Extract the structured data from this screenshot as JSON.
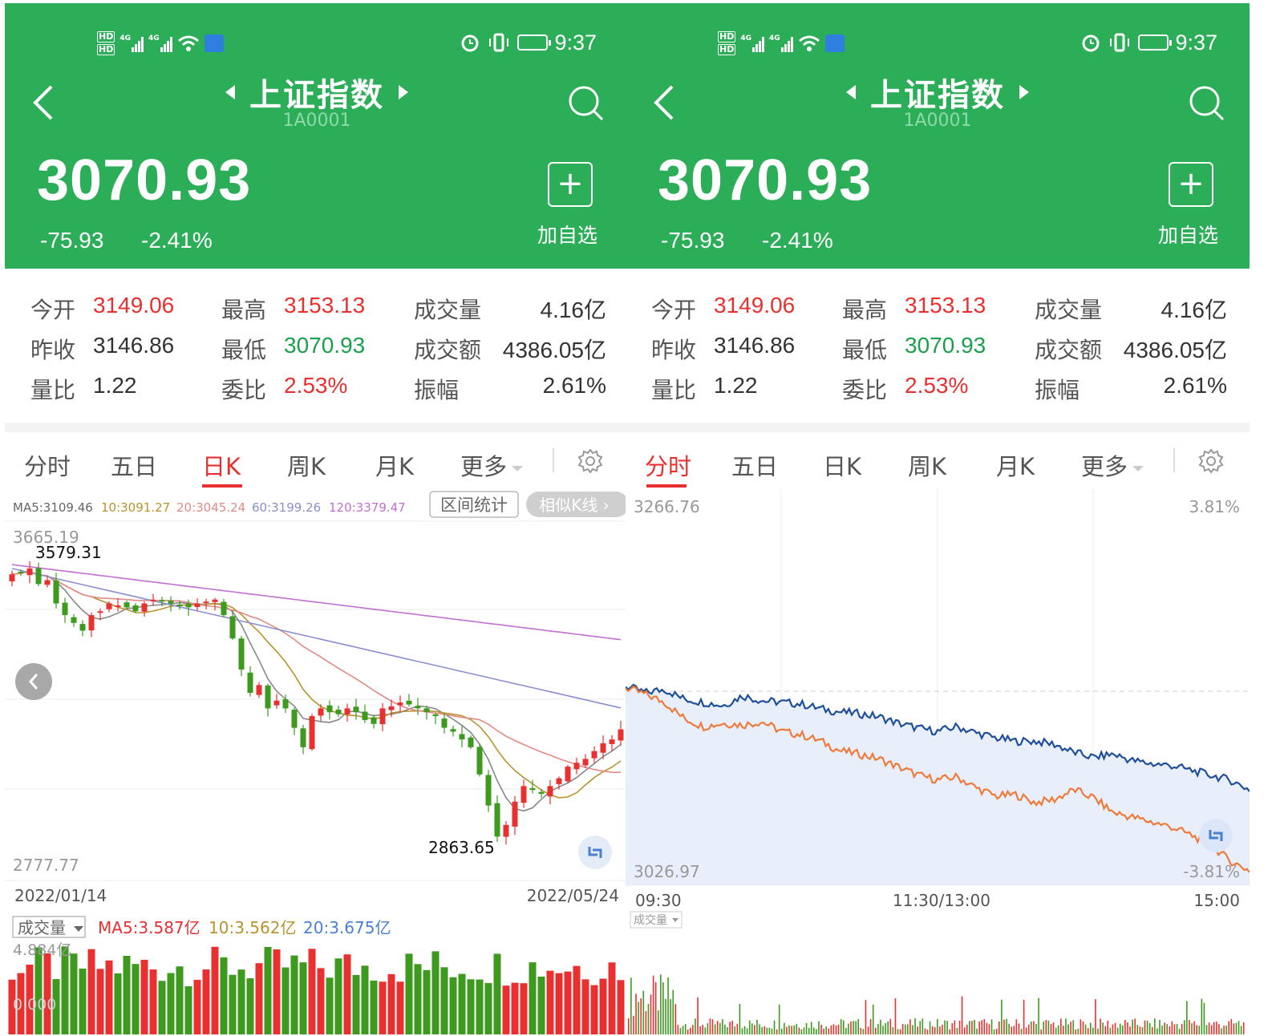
{
  "status_bar": {
    "time": "9:37",
    "hd1": "HD",
    "hd2": "HD",
    "net1": "4G",
    "net2": "4G"
  },
  "header": {
    "title": "上证指数",
    "code": "1A0001",
    "price": "3070.93",
    "change": "-75.93",
    "change_pct": "-2.41%",
    "add_icon": "+",
    "add_label": "加自选"
  },
  "stats": {
    "open_label": "今开",
    "open": "3149.06",
    "high_label": "最高",
    "high": "3153.13",
    "volume_label": "成交量",
    "volume": "4.16亿",
    "prev_close_label": "昨收",
    "prev_close": "3146.86",
    "low_label": "最低",
    "low": "3070.93",
    "amount_label": "成交额",
    "amount": "4386.05亿",
    "vol_ratio_label": "量比",
    "vol_ratio": "1.22",
    "bid_ratio_label": "委比",
    "bid_ratio": "2.53%",
    "amplitude_label": "振幅",
    "amplitude": "2.61%"
  },
  "tabs": [
    "分时",
    "五日",
    "日K",
    "周K",
    "月K",
    "更多"
  ],
  "left_panel": {
    "active_tab": 2,
    "ma_legend": [
      "MA5:3109.46",
      "10:3091.27",
      "20:3045.24",
      "60:3199.26",
      "120:3379.47"
    ],
    "range_stat_button": "区间统计",
    "similar_k_button": "相似K线 ›",
    "y_top": "3665.19",
    "y_bottom": "2777.77",
    "high_marker": "3579.31",
    "low_marker": "2863.65",
    "date_start": "2022/01/14",
    "date_end": "2022/05/24",
    "volume_selector": "成交量",
    "vol_ma": [
      "MA5:3.587亿",
      "10:3.562亿",
      "20:3.675亿"
    ],
    "vol_top": "4.884亿",
    "vol_bottom": "0.000"
  },
  "right_panel": {
    "active_tab": 0,
    "y_top": "3266.76",
    "y_bottom": "3026.97",
    "pct_top": "3.81%",
    "pct_bottom": "-3.81%",
    "time_start": "09:30",
    "time_mid": "11:30/13:00",
    "time_end": "15:00",
    "volume_selector": "成交量"
  },
  "colors": {
    "header": "#2cae58",
    "up": "#e93030",
    "down": "#3d9a1f",
    "ma5": "#888888",
    "ma10": "#b8932f",
    "ma20": "#e48a84",
    "ma60": "#8a8fce",
    "ma120": "#c070d0",
    "index_line": "#1f4e9a",
    "price_line": "#f07a3a"
  },
  "chart_data": [
    {
      "type": "candlestick",
      "title": "",
      "x_range": [
        "2022/01/14",
        "2022/05/24"
      ],
      "ylim": [
        2777.77,
        3665.19
      ],
      "annotations": [
        {
          "label": "3579.31",
          "type": "period_high"
        },
        {
          "label": "2863.65",
          "type": "period_low"
        }
      ],
      "series": [
        {
          "name": "MA5",
          "last": 3109.46
        },
        {
          "name": "10",
          "last": 3091.27
        },
        {
          "name": "20",
          "last": 3045.24
        },
        {
          "name": "60",
          "last": 3199.26
        },
        {
          "name": "120",
          "last": 3379.47
        }
      ],
      "closes": [
        3545,
        3550,
        3560,
        3520,
        3530,
        3470,
        3440,
        3420,
        3400,
        3440,
        3450,
        3470,
        3465,
        3460,
        3450,
        3470,
        3480,
        3475,
        3470,
        3465,
        3460,
        3470,
        3475,
        3480,
        3440,
        3380,
        3300,
        3240,
        3260,
        3200,
        3220,
        3200,
        3150,
        3100,
        3180,
        3200,
        3190,
        3185,
        3200,
        3190,
        3170,
        3160,
        3200,
        3205,
        3215,
        3210,
        3200,
        3190,
        3180,
        3150,
        3140,
        3120,
        3100,
        3030,
        2950,
        2870,
        2900,
        2960,
        3000,
        2990,
        2980,
        3000,
        3020,
        3050,
        3060,
        3070,
        3090,
        3110,
        3120,
        3146
      ]
    },
    {
      "type": "line",
      "title": "",
      "x_ticks": [
        "09:30",
        "11:30/13:00",
        "15:00"
      ],
      "ylim": [
        3026.97,
        3266.76
      ],
      "reference": 3146.86,
      "series": [
        {
          "name": "",
          "values": [
            3150,
            3146,
            3148,
            3142,
            3140,
            3138,
            3144,
            3141,
            3140,
            3139,
            3136,
            3134,
            3133,
            3131,
            3127,
            3124,
            3122,
            3125,
            3121,
            3118,
            3116,
            3116,
            3114,
            3109,
            3106,
            3108,
            3104,
            3102,
            3101,
            3098,
            3095,
            3092,
            3086
          ]
        },
        {
          "name": "",
          "values": [
            3149,
            3145,
            3140,
            3130,
            3125,
            3127,
            3126,
            3128,
            3122,
            3120,
            3116,
            3110,
            3108,
            3105,
            3100,
            3095,
            3092,
            3094,
            3087,
            3082,
            3083,
            3078,
            3080,
            3086,
            3081,
            3072,
            3069,
            3066,
            3063,
            3058,
            3052,
            3042,
            3036
          ]
        }
      ]
    }
  ]
}
